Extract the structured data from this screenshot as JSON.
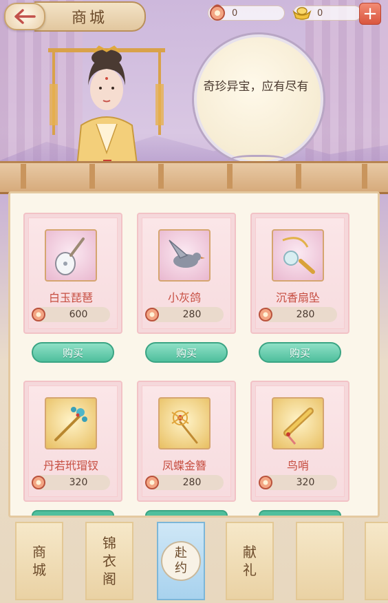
{
  "header": {
    "title": "商城",
    "silver_amount": "0",
    "gold_amount": "0"
  },
  "banner": {
    "speech": "奇珍异宝，应有尽有"
  },
  "shop": {
    "buy_label": "购买",
    "items": [
      {
        "name": "白玉琵琶",
        "price": "600",
        "icon": "pipa-lute-icon"
      },
      {
        "name": "小灰鸽",
        "price": "280",
        "icon": "grey-dove-icon"
      },
      {
        "name": "沉香扇坠",
        "price": "280",
        "icon": "fan-pendant-icon"
      },
      {
        "name": "丹若玳瑁钗",
        "price": "320",
        "icon": "hairpin-icon"
      },
      {
        "name": "凤蝶金簪",
        "price": "280",
        "icon": "gold-hairpin-icon"
      },
      {
        "name": "鸟哨",
        "price": "320",
        "icon": "bird-whistle-icon"
      }
    ]
  },
  "tabs": [
    {
      "label": "商城"
    },
    {
      "label": "锦衣阁"
    },
    {
      "label": "赴约"
    },
    {
      "label": "献礼"
    }
  ],
  "colors": {
    "item_name": "#c64d40",
    "buy_button": "#4fbf9d",
    "panel_bg": "#fbf6ea"
  }
}
